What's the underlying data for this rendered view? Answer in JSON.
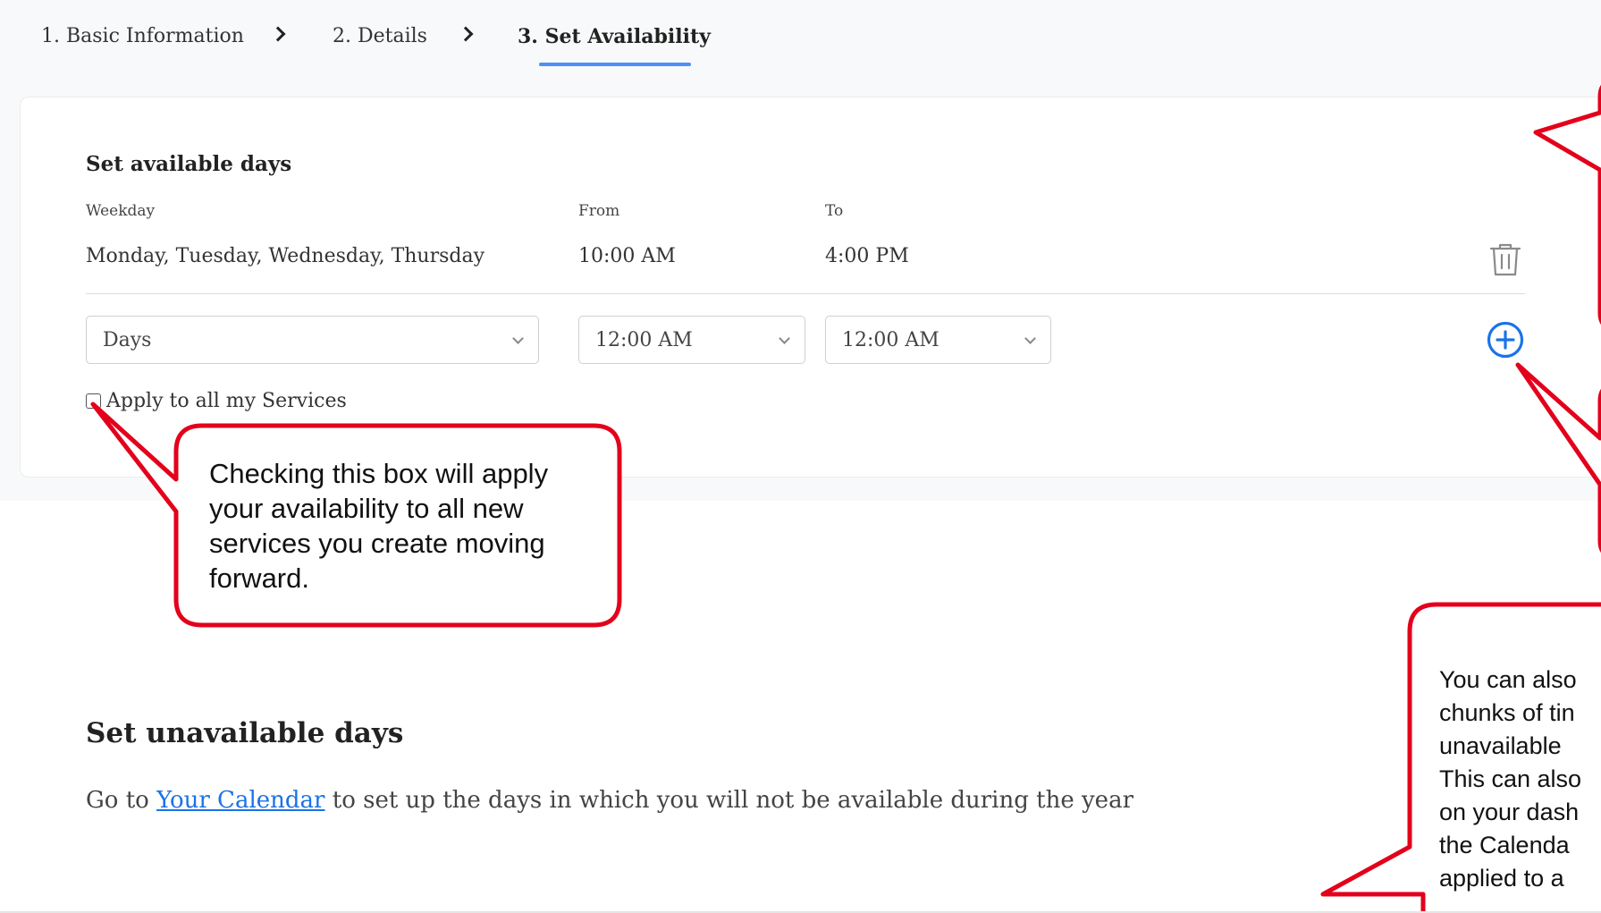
{
  "stepper": {
    "steps": [
      {
        "label": "1. Basic Information"
      },
      {
        "label": "2. Details"
      },
      {
        "label": "3. Set Availability"
      }
    ]
  },
  "available": {
    "title": "Set available days",
    "headers": {
      "weekday": "Weekday",
      "from": "From",
      "to": "To"
    },
    "row": {
      "weekday": "Monday, Tuesday, Wednesday, Thursday",
      "from": "10:00 AM",
      "to": "4:00 PM"
    },
    "inputs": {
      "days": "Days",
      "from": "12:00 AM",
      "to": "12:00 AM"
    },
    "apply_label": "Apply to all my Services",
    "apply_checked": false
  },
  "unavailable": {
    "title": "Set unavailable days",
    "text_before": "Go to ",
    "link_label": "Your Calendar",
    "text_after": " to set up the days in which you will not be available during the year"
  },
  "callouts": {
    "checkbox_note": "Checking this box will apply your availability to all new services you create moving forward.",
    "calendar_note": [
      "You can also",
      "chunks of tin",
      "unavailable",
      "This can also",
      "on your dash",
      "the Calenda",
      "applied to a"
    ]
  },
  "colors": {
    "accent": "#4f8ef7",
    "link": "#1a73e8",
    "plus_icon": "#1a73e8",
    "callout_border": "#e3001b"
  }
}
